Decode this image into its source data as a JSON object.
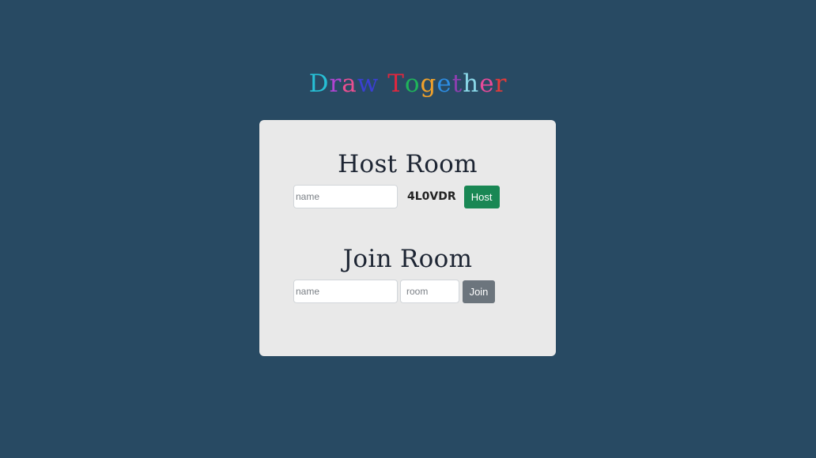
{
  "logo": {
    "letters": [
      {
        "char": "D",
        "color": "#27c0d6"
      },
      {
        "char": "r",
        "color": "#b044d1"
      },
      {
        "char": "a",
        "color": "#e94f91"
      },
      {
        "char": "w",
        "color": "#3a3fd1"
      },
      {
        "char": " ",
        "color": "#000000"
      },
      {
        "char": "T",
        "color": "#e0273e"
      },
      {
        "char": "o",
        "color": "#1fb55a"
      },
      {
        "char": "g",
        "color": "#f0a12b"
      },
      {
        "char": "e",
        "color": "#2d8de3"
      },
      {
        "char": "t",
        "color": "#8e3fb0"
      },
      {
        "char": "h",
        "color": "#8ad8e8"
      },
      {
        "char": "e",
        "color": "#e84a9a"
      },
      {
        "char": "r",
        "color": "#e23a3a"
      }
    ]
  },
  "host": {
    "title": "Host Room",
    "name_placeholder": "name",
    "room_code": "4L0VDR",
    "button_label": "Host"
  },
  "join": {
    "title": "Join Room",
    "name_placeholder": "name",
    "room_placeholder": "room",
    "button_label": "Join"
  },
  "colors": {
    "background": "#284a63",
    "card": "#e9e9e9",
    "host_button": "#198754",
    "join_button": "#6c757d"
  }
}
